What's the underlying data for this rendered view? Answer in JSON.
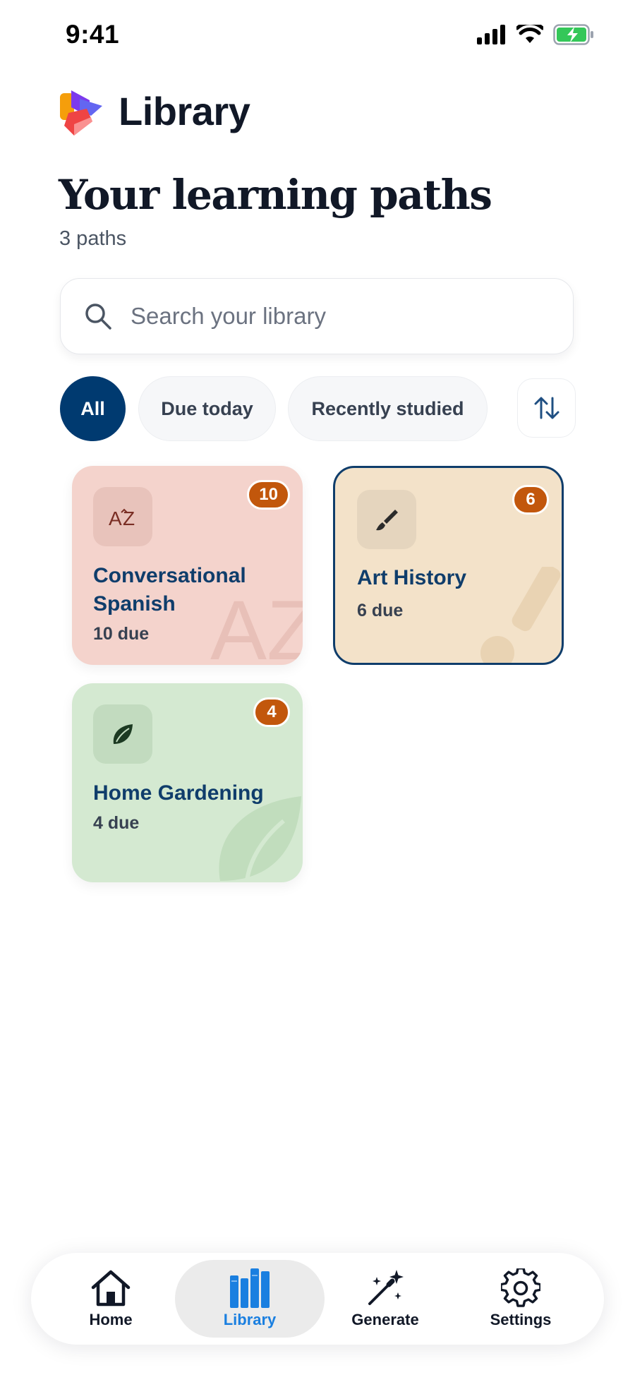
{
  "status_bar": {
    "time": "9:41",
    "icons": [
      "cellular-signal-icon",
      "wifi-icon",
      "battery-charging-icon"
    ],
    "battery_color": "#34c759"
  },
  "header": {
    "app_title": "Library",
    "logo_icon": "app-logo"
  },
  "page": {
    "title": "Your learning paths",
    "count": "3 paths"
  },
  "search": {
    "placeholder": "Search your library",
    "value": ""
  },
  "filters": {
    "chips": [
      {
        "label": "All",
        "active": true
      },
      {
        "label": "Due today",
        "active": false
      },
      {
        "label": "Recently studied",
        "active": false
      }
    ],
    "sort_icon": "sort-arrows-icon"
  },
  "paths": [
    {
      "title": "Conversational Spanish",
      "due": "10 due",
      "badge": "10",
      "icon": "translate-az-icon",
      "color": "#f5d5cf",
      "selected": false
    },
    {
      "title": "Art History",
      "due": "6 due",
      "badge": "6",
      "icon": "paintbrush-icon",
      "color": "#f3e2c9",
      "selected": true
    },
    {
      "title": "Home Gardening",
      "due": "4 due",
      "badge": "4",
      "icon": "leaf-icon",
      "color": "#d4e9d1",
      "selected": false
    }
  ],
  "colors": {
    "primary": "#003a70",
    "badge": "#c2570c",
    "active_nav": "#1a7fe0",
    "selected_border": "#0f3d6b"
  },
  "nav": {
    "items": [
      {
        "label": "Home",
        "icon": "home-icon",
        "active": false
      },
      {
        "label": "Library",
        "icon": "library-books-icon",
        "active": true
      },
      {
        "label": "Generate",
        "icon": "magic-wand-icon",
        "active": false
      },
      {
        "label": "Settings",
        "icon": "gear-icon",
        "active": false
      }
    ]
  }
}
